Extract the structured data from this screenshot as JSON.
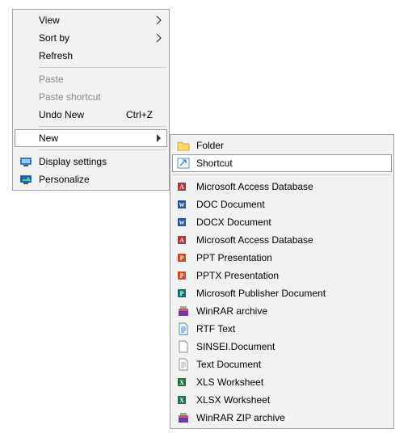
{
  "primary": {
    "view": "View",
    "sort_by": "Sort by",
    "refresh": "Refresh",
    "paste": "Paste",
    "paste_shortcut": "Paste shortcut",
    "undo_new": "Undo New",
    "undo_new_accel": "Ctrl+Z",
    "new": "New",
    "display_settings": "Display settings",
    "personalize": "Personalize"
  },
  "sub": {
    "folder": "Folder",
    "shortcut": "Shortcut",
    "access_db": "Microsoft Access Database",
    "doc": "DOC Document",
    "docx": "DOCX Document",
    "access_db2": "Microsoft Access Database",
    "ppt": "PPT Presentation",
    "pptx": "PPTX Presentation",
    "publisher": "Microsoft Publisher Document",
    "rar": "WinRAR archive",
    "rtf": "RTF Text",
    "sinsei": "SINSEI.Document",
    "txt": "Text Document",
    "xls": "XLS Worksheet",
    "xlsx": "XLSX Worksheet",
    "zip": "WinRAR ZIP archive"
  }
}
